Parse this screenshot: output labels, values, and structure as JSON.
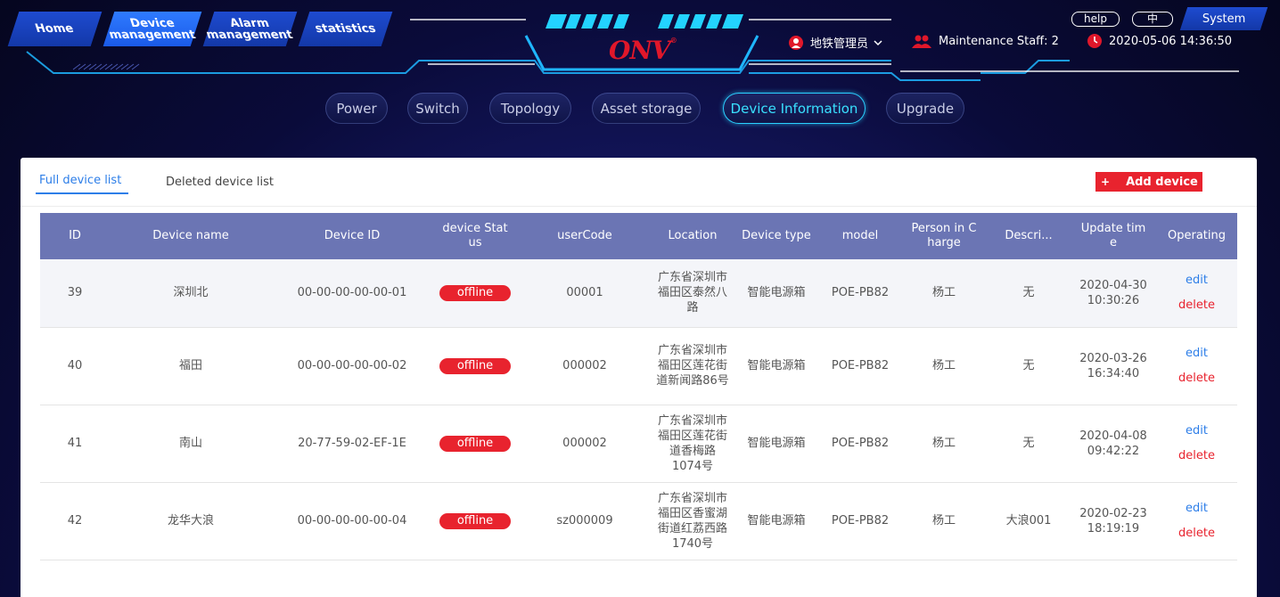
{
  "nav": {
    "tabs": [
      {
        "label_line1": "Home",
        "label_line2": ""
      },
      {
        "label_line1": "Device",
        "label_line2": "management"
      },
      {
        "label_line1": "Alarm",
        "label_line2": "management"
      },
      {
        "label_line1": "statistics",
        "label_line2": ""
      }
    ],
    "active_tab": 1
  },
  "logo": {
    "text": "ONV",
    "mark": "®"
  },
  "header_buttons": {
    "help": "help",
    "lang": "中",
    "system": "System"
  },
  "status": {
    "user": "地铁管理员",
    "maintenance": "Maintenance Staff: 2",
    "datetime": "2020-05-06 14:36:50"
  },
  "sub_tabs": [
    "Power",
    "Switch",
    "Topology",
    "Asset storage",
    "Device Information",
    "Upgrade"
  ],
  "active_sub_tab": 4,
  "panel": {
    "tabs": [
      "Full device list",
      "Deleted device list"
    ],
    "add_button": "Add device",
    "add_icon": "+"
  },
  "table": {
    "headers": [
      "ID",
      "Device name",
      "Device ID",
      "device Stat us",
      "userCode",
      "Location",
      "Device type",
      "model",
      "Person in C harge",
      "Descri...",
      "Update tim e",
      "Operating"
    ],
    "edit_label": "edit",
    "delete_label": "delete",
    "rows": [
      {
        "id": "39",
        "name": "深圳北",
        "device_id": "00-00-00-00-00-01",
        "status": "offline",
        "user_code": "00001",
        "location": "广东省深圳市福田区泰然八路",
        "type": "智能电源箱",
        "model": "POE-PB82",
        "person": "杨工",
        "desc": "无",
        "date": "2020-04-30",
        "time": "10:30:26"
      },
      {
        "id": "40",
        "name": "福田",
        "device_id": "00-00-00-00-00-02",
        "status": "offline",
        "user_code": "000002",
        "location": "广东省深圳市福田区莲花街道新闻路86号",
        "type": "智能电源箱",
        "model": "POE-PB82",
        "person": "杨工",
        "desc": "无",
        "date": "2020-03-26",
        "time": "16:34:40"
      },
      {
        "id": "41",
        "name": "南山",
        "device_id": "20-77-59-02-EF-1E",
        "status": "offline",
        "user_code": "000002",
        "location": "广东省深圳市福田区莲花街道香梅路1074号",
        "type": "智能电源箱",
        "model": "POE-PB82",
        "person": "杨工",
        "desc": "无",
        "date": "2020-04-08",
        "time": "09:42:22"
      },
      {
        "id": "42",
        "name": "龙华大浪",
        "device_id": "00-00-00-00-00-04",
        "status": "offline",
        "user_code": "sz000009",
        "location": "广东省深圳市福田区香蜜湖街道红荔西路1740号",
        "type": "智能电源箱",
        "model": "POE-PB82",
        "person": "杨工",
        "desc": "大浪001",
        "date": "2020-02-23",
        "time": "18:19:19"
      }
    ]
  },
  "colors": {
    "accent": "#2d7ee8",
    "danger": "#e8232e",
    "header_bg": "#6b75b4",
    "glow": "#2ad0ff"
  },
  "icons": {
    "user": "user-icon",
    "staff": "staff-icon",
    "clock": "clock-icon",
    "dropdown": "chevron-down-icon"
  }
}
